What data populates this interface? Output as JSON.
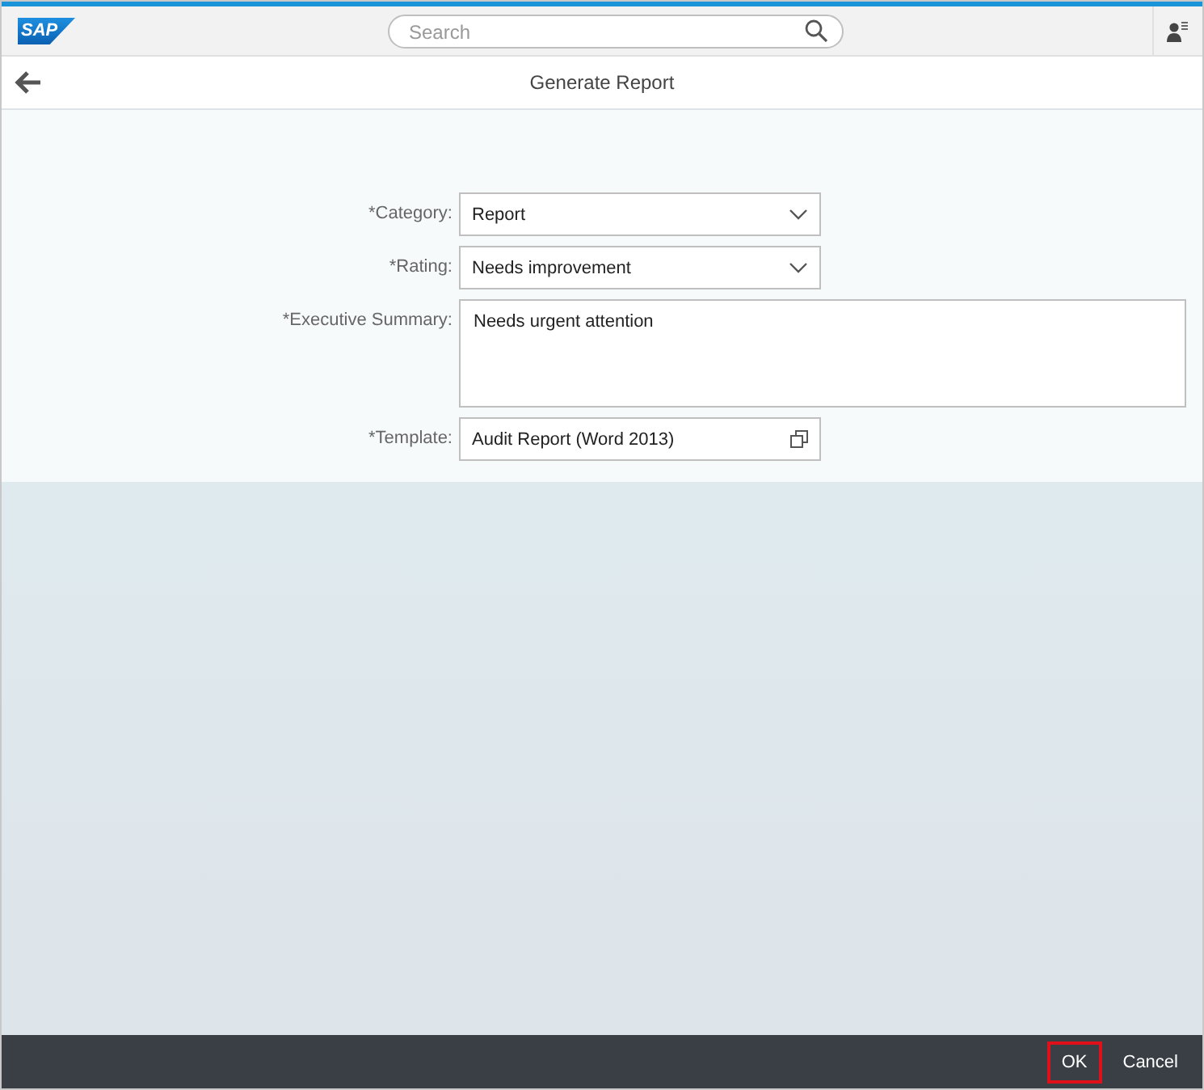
{
  "shell": {
    "logo": "SAP",
    "search": {
      "placeholder": "Search"
    }
  },
  "page": {
    "title": "Generate Report"
  },
  "form": {
    "fields": [
      {
        "kind": "select",
        "label": "*Category:",
        "value": "Report"
      },
      {
        "kind": "select",
        "label": "*Rating:",
        "value": "Needs improvement"
      },
      {
        "kind": "textarea",
        "label": "*Executive Summary:",
        "value": "Needs urgent attention"
      },
      {
        "kind": "valuehelp",
        "label": "*Template:",
        "value": "Audit Report (Word 2013)"
      }
    ]
  },
  "footer": {
    "buttons": [
      {
        "label": "OK",
        "highlighted": true
      },
      {
        "label": "Cancel",
        "highlighted": false
      }
    ]
  }
}
